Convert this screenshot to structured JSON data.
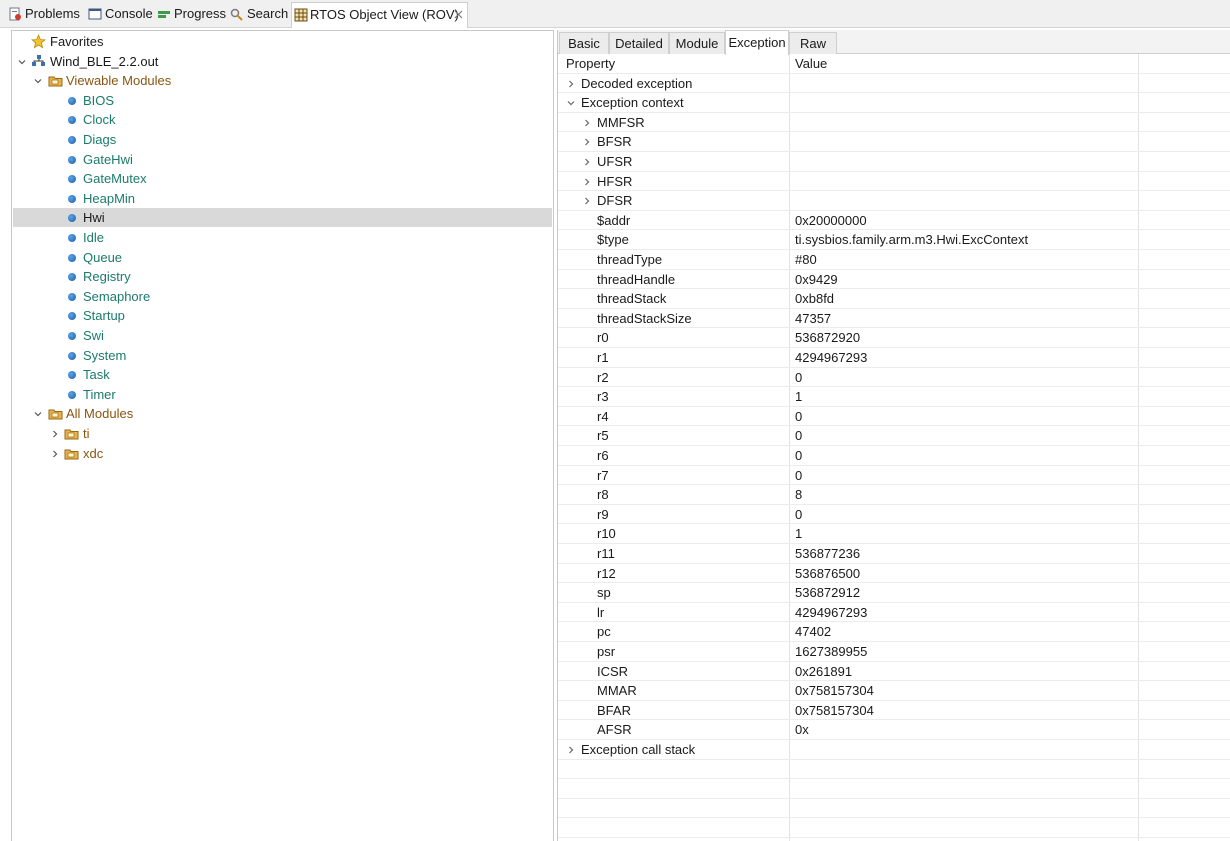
{
  "view_tabs": [
    {
      "label": "Problems",
      "icon": "problems-icon"
    },
    {
      "label": "Console",
      "icon": "console-icon"
    },
    {
      "label": "Progress",
      "icon": "progress-icon"
    },
    {
      "label": "Search",
      "icon": "search-icon"
    },
    {
      "label": "RTOS Object View (ROV)",
      "icon": "rov-table-icon",
      "active": true
    }
  ],
  "tree": {
    "favorites": "Favorites",
    "program": "Wind_BLE_2.2.out",
    "viewable_modules_label": "Viewable Modules",
    "viewable_modules": [
      "BIOS",
      "Clock",
      "Diags",
      "GateHwi",
      "GateMutex",
      "HeapMin",
      "Hwi",
      "Idle",
      "Queue",
      "Registry",
      "Semaphore",
      "Startup",
      "Swi",
      "System",
      "Task",
      "Timer"
    ],
    "selected_module": "Hwi",
    "all_modules_label": "All Modules",
    "all_modules": [
      "ti",
      "xdc"
    ]
  },
  "sub_tabs": [
    "Basic",
    "Detailed",
    "Module",
    "Exception",
    "Raw"
  ],
  "active_sub_tab": "Exception",
  "table": {
    "headers": [
      "Property",
      "Value"
    ],
    "rows": [
      {
        "property": "Decoded exception",
        "value": "",
        "level": 0,
        "expander": "collapsed"
      },
      {
        "property": "Exception context",
        "value": "",
        "level": 0,
        "expander": "expanded"
      },
      {
        "property": "MMFSR",
        "value": "",
        "level": 1,
        "expander": "collapsed"
      },
      {
        "property": "BFSR",
        "value": "",
        "level": 1,
        "expander": "collapsed"
      },
      {
        "property": "UFSR",
        "value": "",
        "level": 1,
        "expander": "collapsed"
      },
      {
        "property": "HFSR",
        "value": "",
        "level": 1,
        "expander": "collapsed"
      },
      {
        "property": "DFSR",
        "value": "",
        "level": 1,
        "expander": "collapsed"
      },
      {
        "property": "$addr",
        "value": "0x20000000",
        "level": 1
      },
      {
        "property": "$type",
        "value": "ti.sysbios.family.arm.m3.Hwi.ExcContext",
        "level": 1
      },
      {
        "property": "threadType",
        "value": "#80",
        "level": 1
      },
      {
        "property": "threadHandle",
        "value": "0x9429",
        "level": 1
      },
      {
        "property": "threadStack",
        "value": "0xb8fd",
        "level": 1
      },
      {
        "property": "threadStackSize",
        "value": "47357",
        "level": 1
      },
      {
        "property": "r0",
        "value": "536872920",
        "level": 1
      },
      {
        "property": "r1",
        "value": "4294967293",
        "level": 1
      },
      {
        "property": "r2",
        "value": "0",
        "level": 1
      },
      {
        "property": "r3",
        "value": "1",
        "level": 1
      },
      {
        "property": "r4",
        "value": "0",
        "level": 1
      },
      {
        "property": "r5",
        "value": "0",
        "level": 1
      },
      {
        "property": "r6",
        "value": "0",
        "level": 1
      },
      {
        "property": "r7",
        "value": "0",
        "level": 1
      },
      {
        "property": "r8",
        "value": "8",
        "level": 1
      },
      {
        "property": "r9",
        "value": "0",
        "level": 1
      },
      {
        "property": "r10",
        "value": "1",
        "level": 1
      },
      {
        "property": "r11",
        "value": "536877236",
        "level": 1
      },
      {
        "property": "r12",
        "value": "536876500",
        "level": 1
      },
      {
        "property": "sp",
        "value": "536872912",
        "level": 1
      },
      {
        "property": "lr",
        "value": "4294967293",
        "level": 1
      },
      {
        "property": "pc",
        "value": "47402",
        "level": 1
      },
      {
        "property": "psr",
        "value": "1627389955",
        "level": 1
      },
      {
        "property": "ICSR",
        "value": "0x261891",
        "level": 1
      },
      {
        "property": "MMAR",
        "value": "0x758157304",
        "level": 1
      },
      {
        "property": "BFAR",
        "value": "0x758157304",
        "level": 1
      },
      {
        "property": "AFSR",
        "value": "0x",
        "level": 1
      },
      {
        "property": "Exception call stack",
        "value": "",
        "level": 0,
        "expander": "collapsed"
      }
    ]
  },
  "colors": {
    "module_text": "#1c7a6c",
    "folder_text": "#8a5510",
    "selection": "#d9d9d9"
  }
}
